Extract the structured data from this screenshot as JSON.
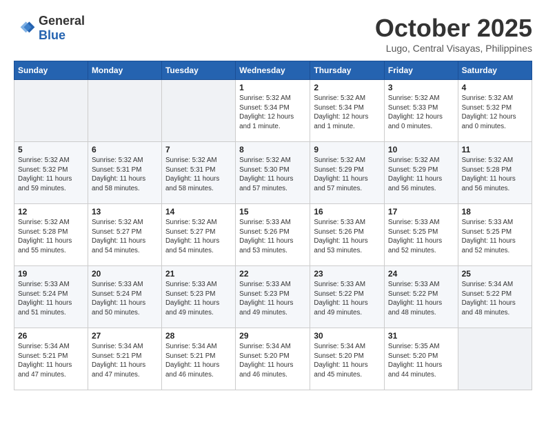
{
  "header": {
    "logo_line1": "General",
    "logo_line2": "Blue",
    "month": "October 2025",
    "location": "Lugo, Central Visayas, Philippines"
  },
  "days_of_week": [
    "Sunday",
    "Monday",
    "Tuesday",
    "Wednesday",
    "Thursday",
    "Friday",
    "Saturday"
  ],
  "weeks": [
    [
      {
        "day": "",
        "info": ""
      },
      {
        "day": "",
        "info": ""
      },
      {
        "day": "",
        "info": ""
      },
      {
        "day": "1",
        "info": "Sunrise: 5:32 AM\nSunset: 5:34 PM\nDaylight: 12 hours\nand 1 minute."
      },
      {
        "day": "2",
        "info": "Sunrise: 5:32 AM\nSunset: 5:34 PM\nDaylight: 12 hours\nand 1 minute."
      },
      {
        "day": "3",
        "info": "Sunrise: 5:32 AM\nSunset: 5:33 PM\nDaylight: 12 hours\nand 0 minutes."
      },
      {
        "day": "4",
        "info": "Sunrise: 5:32 AM\nSunset: 5:32 PM\nDaylight: 12 hours\nand 0 minutes."
      }
    ],
    [
      {
        "day": "5",
        "info": "Sunrise: 5:32 AM\nSunset: 5:32 PM\nDaylight: 11 hours\nand 59 minutes."
      },
      {
        "day": "6",
        "info": "Sunrise: 5:32 AM\nSunset: 5:31 PM\nDaylight: 11 hours\nand 58 minutes."
      },
      {
        "day": "7",
        "info": "Sunrise: 5:32 AM\nSunset: 5:31 PM\nDaylight: 11 hours\nand 58 minutes."
      },
      {
        "day": "8",
        "info": "Sunrise: 5:32 AM\nSunset: 5:30 PM\nDaylight: 11 hours\nand 57 minutes."
      },
      {
        "day": "9",
        "info": "Sunrise: 5:32 AM\nSunset: 5:29 PM\nDaylight: 11 hours\nand 57 minutes."
      },
      {
        "day": "10",
        "info": "Sunrise: 5:32 AM\nSunset: 5:29 PM\nDaylight: 11 hours\nand 56 minutes."
      },
      {
        "day": "11",
        "info": "Sunrise: 5:32 AM\nSunset: 5:28 PM\nDaylight: 11 hours\nand 56 minutes."
      }
    ],
    [
      {
        "day": "12",
        "info": "Sunrise: 5:32 AM\nSunset: 5:28 PM\nDaylight: 11 hours\nand 55 minutes."
      },
      {
        "day": "13",
        "info": "Sunrise: 5:32 AM\nSunset: 5:27 PM\nDaylight: 11 hours\nand 54 minutes."
      },
      {
        "day": "14",
        "info": "Sunrise: 5:32 AM\nSunset: 5:27 PM\nDaylight: 11 hours\nand 54 minutes."
      },
      {
        "day": "15",
        "info": "Sunrise: 5:33 AM\nSunset: 5:26 PM\nDaylight: 11 hours\nand 53 minutes."
      },
      {
        "day": "16",
        "info": "Sunrise: 5:33 AM\nSunset: 5:26 PM\nDaylight: 11 hours\nand 53 minutes."
      },
      {
        "day": "17",
        "info": "Sunrise: 5:33 AM\nSunset: 5:25 PM\nDaylight: 11 hours\nand 52 minutes."
      },
      {
        "day": "18",
        "info": "Sunrise: 5:33 AM\nSunset: 5:25 PM\nDaylight: 11 hours\nand 52 minutes."
      }
    ],
    [
      {
        "day": "19",
        "info": "Sunrise: 5:33 AM\nSunset: 5:24 PM\nDaylight: 11 hours\nand 51 minutes."
      },
      {
        "day": "20",
        "info": "Sunrise: 5:33 AM\nSunset: 5:24 PM\nDaylight: 11 hours\nand 50 minutes."
      },
      {
        "day": "21",
        "info": "Sunrise: 5:33 AM\nSunset: 5:23 PM\nDaylight: 11 hours\nand 49 minutes."
      },
      {
        "day": "22",
        "info": "Sunrise: 5:33 AM\nSunset: 5:23 PM\nDaylight: 11 hours\nand 49 minutes."
      },
      {
        "day": "23",
        "info": "Sunrise: 5:33 AM\nSunset: 5:22 PM\nDaylight: 11 hours\nand 49 minutes."
      },
      {
        "day": "24",
        "info": "Sunrise: 5:33 AM\nSunset: 5:22 PM\nDaylight: 11 hours\nand 48 minutes."
      },
      {
        "day": "25",
        "info": "Sunrise: 5:34 AM\nSunset: 5:22 PM\nDaylight: 11 hours\nand 48 minutes."
      }
    ],
    [
      {
        "day": "26",
        "info": "Sunrise: 5:34 AM\nSunset: 5:21 PM\nDaylight: 11 hours\nand 47 minutes."
      },
      {
        "day": "27",
        "info": "Sunrise: 5:34 AM\nSunset: 5:21 PM\nDaylight: 11 hours\nand 47 minutes."
      },
      {
        "day": "28",
        "info": "Sunrise: 5:34 AM\nSunset: 5:21 PM\nDaylight: 11 hours\nand 46 minutes."
      },
      {
        "day": "29",
        "info": "Sunrise: 5:34 AM\nSunset: 5:20 PM\nDaylight: 11 hours\nand 46 minutes."
      },
      {
        "day": "30",
        "info": "Sunrise: 5:34 AM\nSunset: 5:20 PM\nDaylight: 11 hours\nand 45 minutes."
      },
      {
        "day": "31",
        "info": "Sunrise: 5:35 AM\nSunset: 5:20 PM\nDaylight: 11 hours\nand 44 minutes."
      },
      {
        "day": "",
        "info": ""
      }
    ]
  ]
}
